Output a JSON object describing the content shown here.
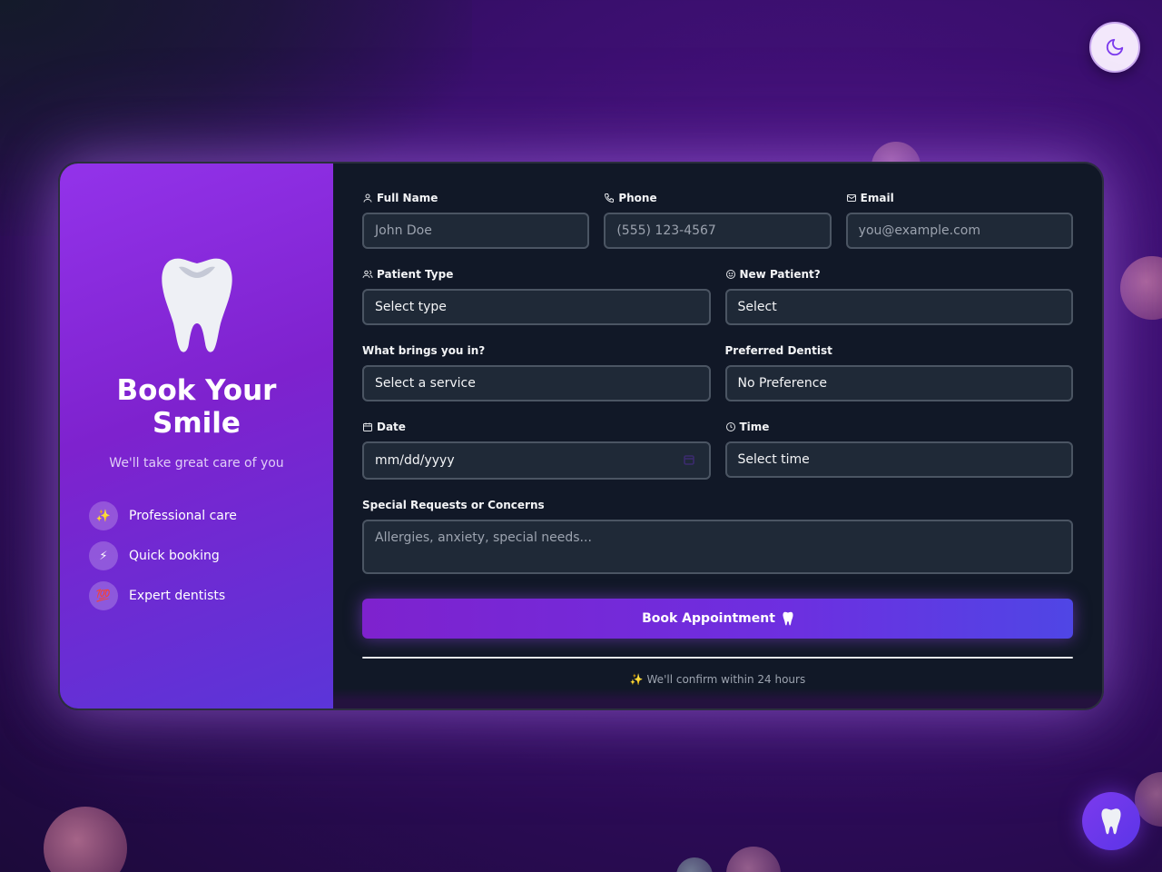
{
  "header": {
    "theme_toggle_icon": "moon-icon"
  },
  "sidebar": {
    "title": "Book Your Smile",
    "tagline": "We'll take great care of you",
    "features": [
      {
        "icon": "✨",
        "label": "Professional care"
      },
      {
        "icon": "⚡",
        "label": "Quick booking"
      },
      {
        "icon": "💯",
        "label": "Expert dentists"
      }
    ]
  },
  "form": {
    "full_name": {
      "label": "Full Name",
      "placeholder": "John Doe"
    },
    "phone": {
      "label": "Phone",
      "placeholder": "(555) 123-4567"
    },
    "email": {
      "label": "Email",
      "placeholder": "you@example.com"
    },
    "patient_type": {
      "label": "Patient Type",
      "value": "Select type"
    },
    "new_patient": {
      "label": "New Patient?",
      "value": "Select"
    },
    "service": {
      "label": "What brings you in?",
      "value": "Select a service"
    },
    "dentist": {
      "label": "Preferred Dentist",
      "value": "No Preference"
    },
    "date": {
      "label": "Date",
      "value": "mm/dd/yyyy"
    },
    "time": {
      "label": "Time",
      "value": "Select time"
    },
    "requests": {
      "label": "Special Requests or Concerns",
      "placeholder": "Allergies, anxiety, special needs..."
    },
    "submit_label": "Book Appointment",
    "confirm_note": "✨ We'll confirm within 24 hours"
  },
  "colors": {
    "accent_purple": "#9333ea",
    "accent_indigo": "#4f46e5",
    "panel_bg": "#111827",
    "field_bg": "#1f2937"
  }
}
